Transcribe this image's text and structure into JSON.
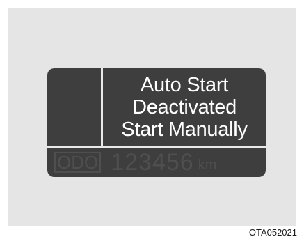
{
  "display": {
    "message_lines": [
      "Auto Start",
      "Deactivated",
      "Start Manually"
    ],
    "odometer": {
      "label": "ODO",
      "value": "123456",
      "unit": "km"
    }
  },
  "caption": "OTA052021"
}
